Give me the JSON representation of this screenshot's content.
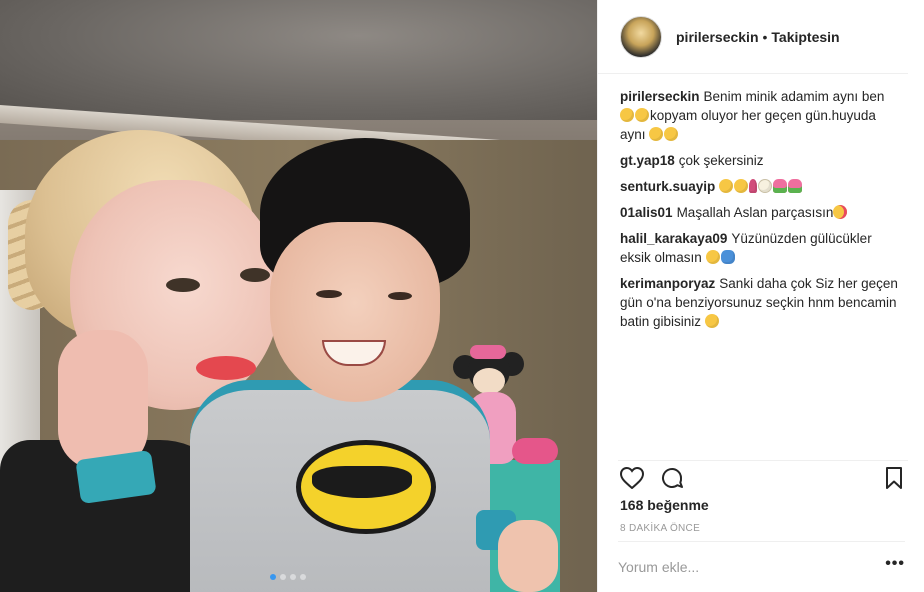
{
  "post": {
    "username": "pirilerseckin",
    "separator": "•",
    "follow_status": "Takiptesin",
    "likes": "168 beğenme",
    "time": "8 DAKİKA ÖNCE",
    "comment_placeholder": "Yorum ekle...",
    "more_label": "•••",
    "carousel": {
      "count": 4,
      "active_index": 0
    }
  },
  "comments": [
    {
      "user": "pirilerseckin",
      "parts": [
        "Benim minik adamim aynı ben",
        "kopyam oluyor her geçen gün.huyuda aynı"
      ]
    },
    {
      "user": "gt.yap18",
      "parts": [
        "çok şekersiniz"
      ]
    },
    {
      "user": "senturk.suayip",
      "parts": [
        ""
      ]
    },
    {
      "user": "01alis01",
      "parts": [
        "Maşallah Aslan parçasısın"
      ]
    },
    {
      "user": "halil_karakaya09",
      "parts": [
        "Yüzünüzden gülücükler eksik olmasın"
      ]
    },
    {
      "user": "kerimanporyaz",
      "parts": [
        "Sanki daha çok Siz her geçen gün o'na benziyorsunuz seçkin hnm bencamin batin gibisiniz"
      ]
    }
  ],
  "icons": {
    "like": "heart-icon",
    "comment": "comment-icon",
    "save": "bookmark-icon",
    "more": "more-options-icon"
  },
  "colors": {
    "text": "#262626",
    "muted": "#999999",
    "border": "#efefef",
    "carousel_active": "#3897f0"
  }
}
